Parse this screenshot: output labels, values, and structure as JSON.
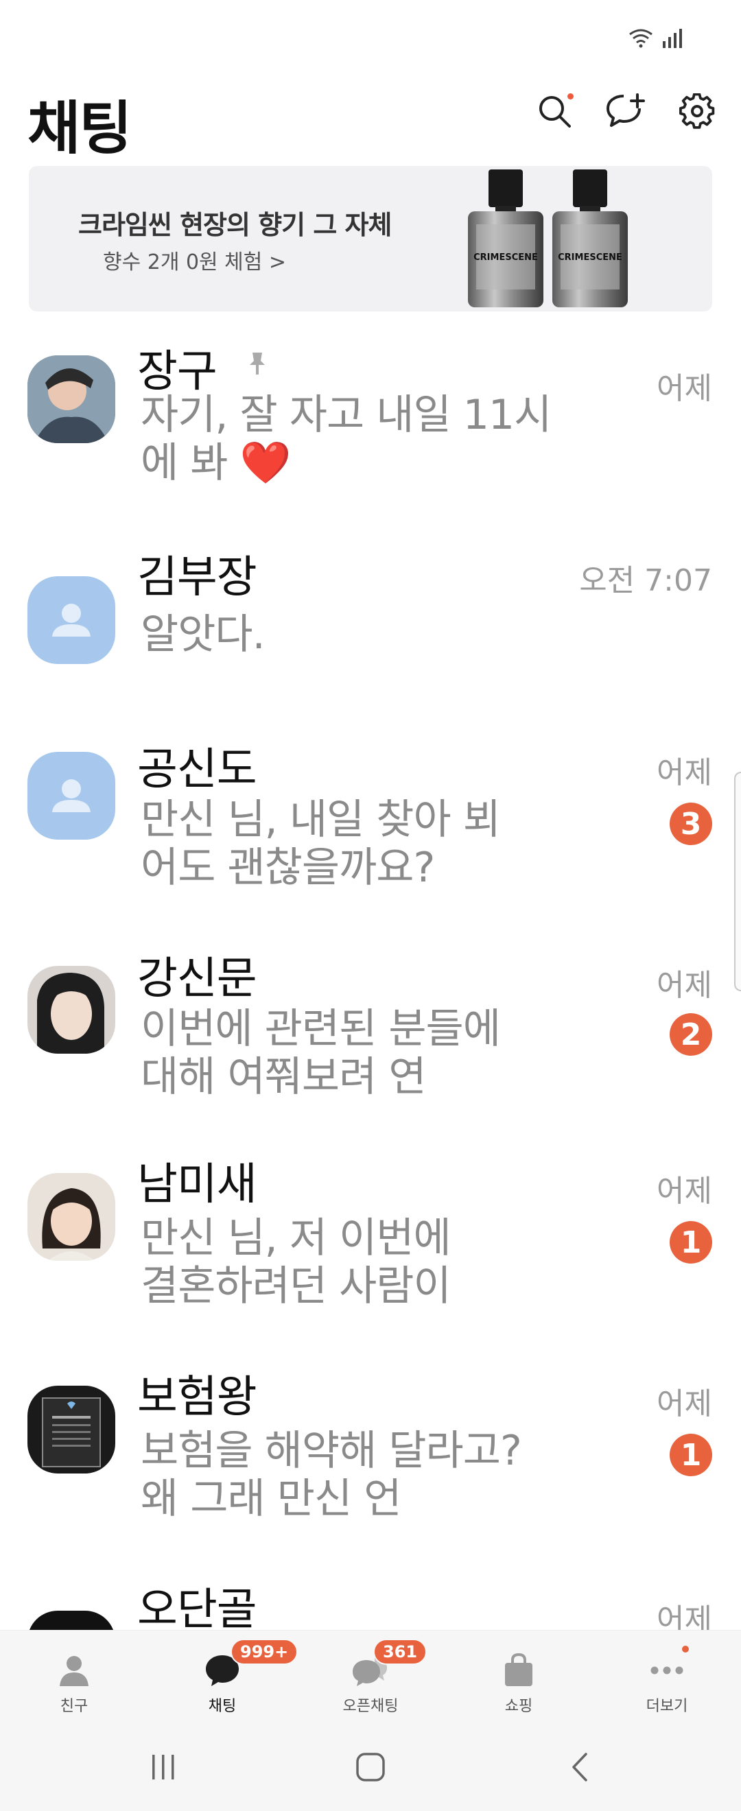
{
  "header": {
    "title": "채팅"
  },
  "ad": {
    "title": "크라임씬 현장의 향기 그 자체",
    "subtitle": "향수 2개  0원 체험 >",
    "bottle_label": "CRIMESCENE"
  },
  "chats": [
    {
      "name": "장구",
      "message": "자기, 잘 자고 내일 11시에 봐 ❤️",
      "time": "어제",
      "unread": "",
      "pinned": true
    },
    {
      "name": "김부장",
      "message": "알앗다.",
      "time": "오전 7:07",
      "unread": ""
    },
    {
      "name": "공신도",
      "message": "만신 님, 내일 찾아 뵈어도 괜찮을까요?",
      "time": "어제",
      "unread": "3"
    },
    {
      "name": "강신문",
      "message": "이번에 관련된 분들에 대해 여쭤보려 연",
      "time": "어제",
      "unread": "2"
    },
    {
      "name": "남미새",
      "message": "만신 님, 저 이번에 결혼하려던 사람이",
      "time": "어제",
      "unread": "1"
    },
    {
      "name": "보험왕",
      "message": "보험을 해약해 달라고? 왜 그래 만신 언",
      "time": "어제",
      "unread": "1"
    },
    {
      "name": "오단골",
      "message": "",
      "time": "어제",
      "unread": ""
    }
  ],
  "tabs": [
    {
      "label": "친구",
      "badge": ""
    },
    {
      "label": "채팅",
      "badge": "999+"
    },
    {
      "label": "오픈채팅",
      "badge": "361"
    },
    {
      "label": "쇼핑",
      "badge": ""
    },
    {
      "label": "더보기",
      "badge": ""
    }
  ],
  "colors": {
    "badge": "#e8623d",
    "default_avatar": "#a7c8ec",
    "time_text": "#9a9a9a",
    "message_text": "#8a8a8a"
  }
}
